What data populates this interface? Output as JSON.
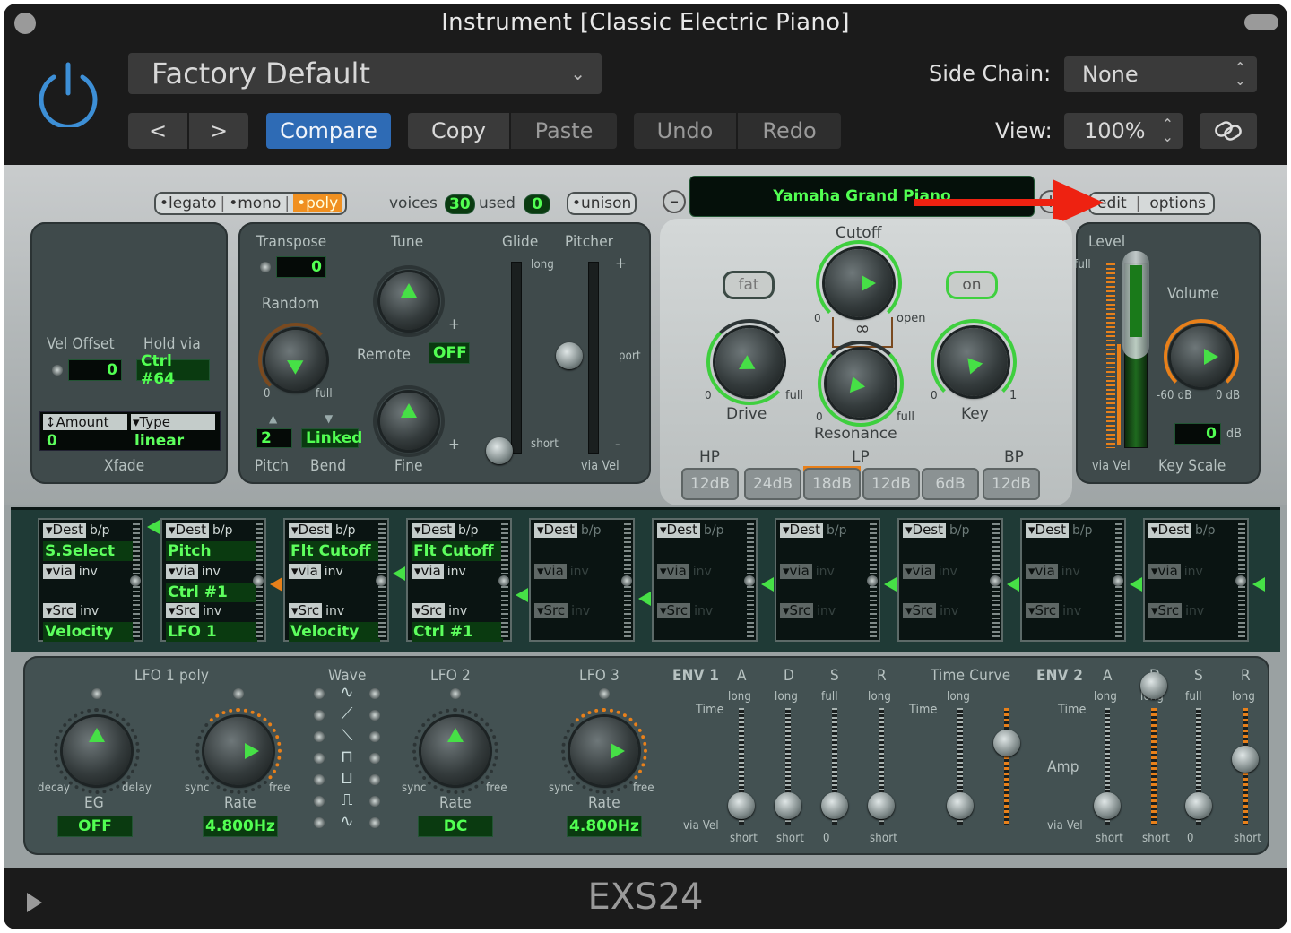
{
  "window": {
    "title": "Instrument [Classic Electric Piano]",
    "footer_name": "EXS24"
  },
  "header": {
    "preset": "Factory Default",
    "side_chain_label": "Side Chain:",
    "side_chain_value": "None",
    "view_label": "View:",
    "view_value": "100%",
    "buttons": {
      "prev": "<",
      "next": ">",
      "compare": "Compare",
      "copy": "Copy",
      "paste": "Paste",
      "undo": "Undo",
      "redo": "Redo"
    }
  },
  "top_bar": {
    "legato": "•legato",
    "mono": "•mono",
    "poly": "•poly",
    "voices_label": "voices",
    "voices_value": "30",
    "used_label": "used",
    "used_value": "0",
    "unison": "•unison",
    "instrument_name": "Yamaha Grand Piano",
    "edit": "edit",
    "options": "options"
  },
  "velocity": {
    "vel_offset_label": "Vel Offset",
    "vel_offset_value": "0",
    "hold_via_label": "Hold via",
    "hold_via_value": "Ctrl #64",
    "amount_label": "Amount",
    "type_label": "Type",
    "amount_value": "0",
    "type_value": "linear",
    "xfade_label": "Xfade"
  },
  "pitch": {
    "transpose_label": "Transpose",
    "transpose_value": "0",
    "tune_label": "Tune",
    "random_label": "Random",
    "random_min": "0",
    "random_max": "full",
    "remote_label": "Remote",
    "remote_value": "OFF",
    "bend_up": "2",
    "bend_mode": "Linked",
    "pitch_label": "Pitch",
    "bend_label": "Bend",
    "fine_label": "Fine",
    "glide_label": "Glide",
    "pitcher_label": "Pitcher",
    "long": "long",
    "short": "short",
    "port": "port",
    "via_vel": "via Vel",
    "plus": "+",
    "minus": "-"
  },
  "filter": {
    "cutoff_label": "Cutoff",
    "fat": "fat",
    "on": "on",
    "open": "open",
    "zero": "0",
    "full": "full",
    "drive_label": "Drive",
    "resonance_label": "Resonance",
    "key_label": "Key",
    "key_max": "1",
    "hp": "HP",
    "lp": "LP",
    "bp": "BP",
    "tabs": [
      "12dB",
      "24dB",
      "18dB",
      "12dB",
      "6dB",
      "12dB"
    ]
  },
  "output": {
    "level_label": "Level",
    "full": "full",
    "volume_label": "Volume",
    "vol_min": "-60 dB",
    "vol_max": "0 dB",
    "key_scale_value": "0",
    "db": "dB",
    "via_vel": "via Vel",
    "key_scale_label": "Key Scale"
  },
  "mod_matrix": {
    "dest": "Dest",
    "bp": "b/p",
    "via": "via",
    "inv": "inv",
    "src": "Src",
    "slots": [
      {
        "dest": "S.Select",
        "via": "",
        "src": "Velocity"
      },
      {
        "dest": "Pitch",
        "via": "Ctrl #1",
        "src": "LFO 1"
      },
      {
        "dest": "Flt Cutoff",
        "via": "",
        "src": "Velocity"
      },
      {
        "dest": "Flt Cutoff",
        "via": "",
        "src": "Ctrl #1"
      },
      {
        "dest": "",
        "via": "",
        "src": ""
      },
      {
        "dest": "",
        "via": "",
        "src": ""
      },
      {
        "dest": "",
        "via": "",
        "src": ""
      },
      {
        "dest": "",
        "via": "",
        "src": ""
      },
      {
        "dest": "",
        "via": "",
        "src": ""
      },
      {
        "dest": "",
        "via": "",
        "src": ""
      }
    ]
  },
  "lfo": {
    "lfo1_label": "LFO 1 poly",
    "decay": "decay",
    "delay": "delay",
    "eg_label": "EG",
    "eg_value": "OFF",
    "sync": "sync",
    "free": "free",
    "rate_label": "Rate",
    "lfo1_rate": "4.800Hz",
    "wave_label": "Wave",
    "lfo2_label": "LFO 2",
    "lfo2_rate": "DC",
    "lfo3_label": "LFO 3",
    "lfo3_rate": "4.800Hz"
  },
  "envelopes": {
    "env1_label": "ENV 1",
    "env2_label": "ENV 2",
    "a": "A",
    "d": "D",
    "s": "S",
    "r": "R",
    "long": "long",
    "full": "full",
    "time": "Time",
    "time_curve": "Time Curve",
    "amp": "Amp",
    "via_vel": "via Vel",
    "short": "short",
    "zero": "0"
  },
  "colors": {
    "accent_blue": "#3d8fd6",
    "lcd_green": "#52ff52",
    "orange": "#e8801a",
    "arrow_red": "#ee2211"
  }
}
